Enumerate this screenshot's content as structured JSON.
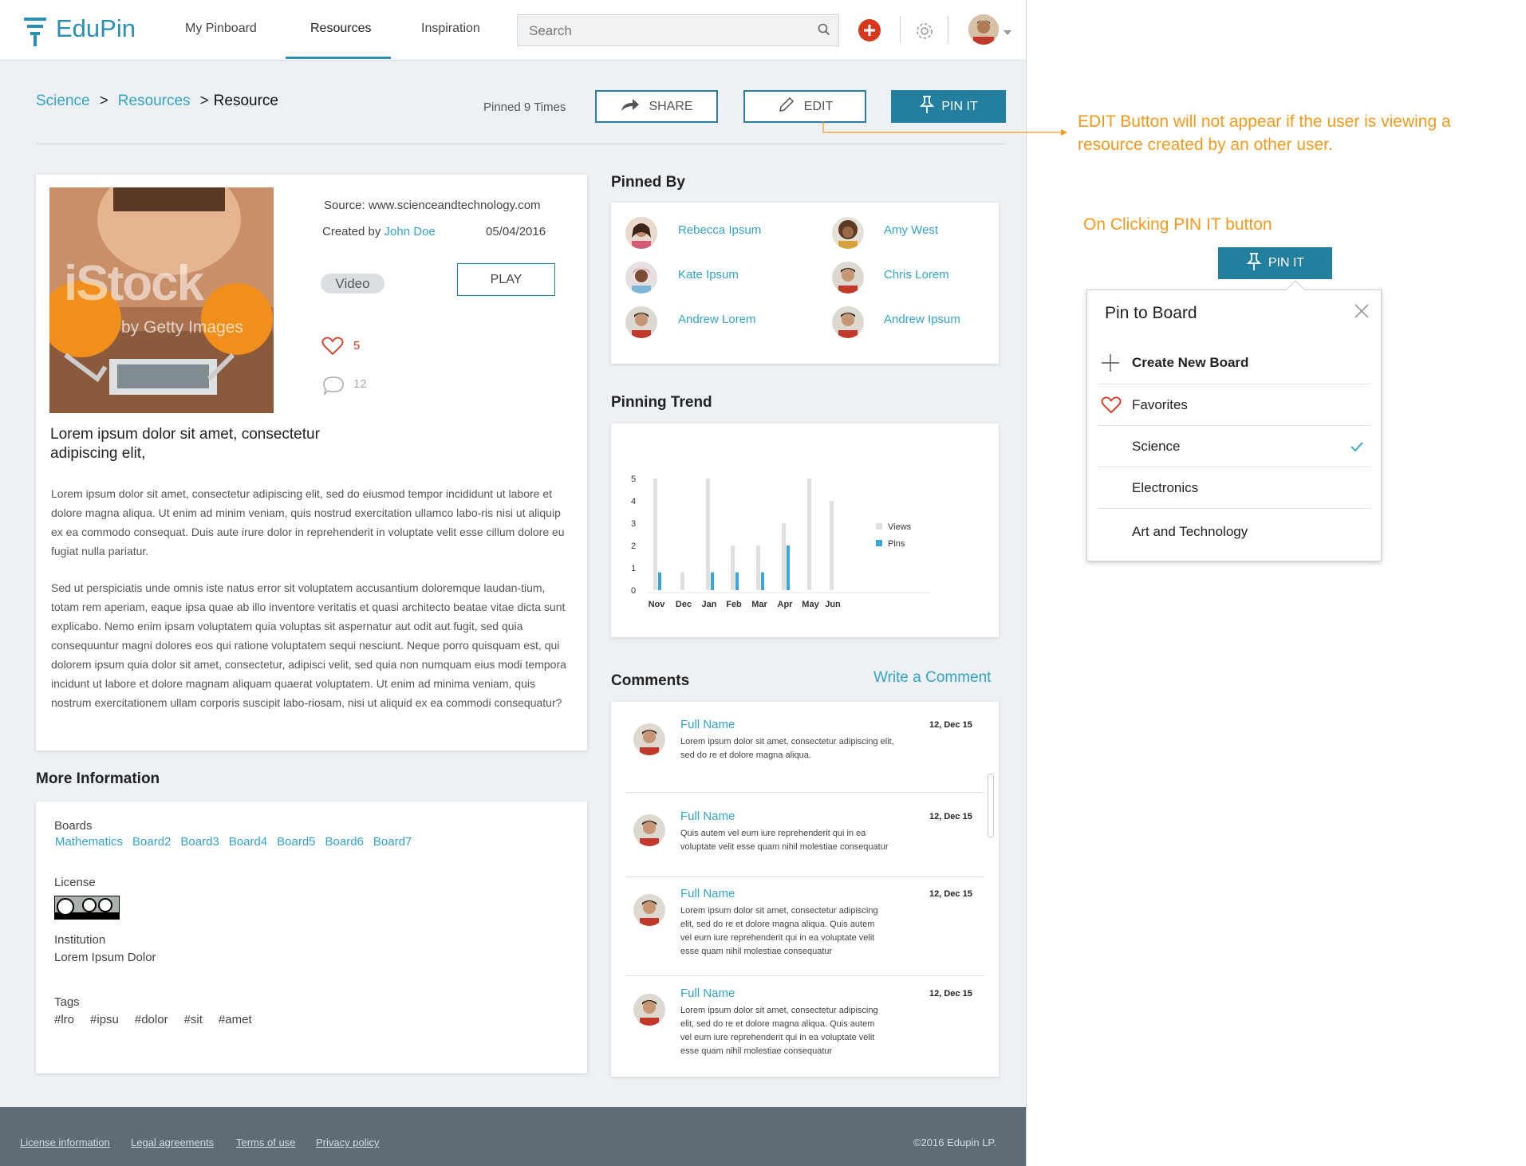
{
  "brand": {
    "name": "EduPin"
  },
  "nav": {
    "items": [
      "My Pinboard",
      "Resources",
      "Inspiration"
    ],
    "active_index": 1
  },
  "search": {
    "placeholder": "Search"
  },
  "breadcrumb": {
    "items": [
      "Science",
      "Resources"
    ],
    "current": "Resource",
    "separator": ">"
  },
  "actions": {
    "pinned_count": "Pinned 9 Times",
    "share": "SHARE",
    "edit": "EDIT",
    "pin_it": "PIN IT"
  },
  "resource": {
    "image_watermark": "iStock",
    "image_watermark_sub": "by Getty Images",
    "source": "Source: www.scienceandtechnology.com",
    "created_by_label": "Created by",
    "author": "John Doe",
    "date": "05/04/2016",
    "type_badge": "Video",
    "play": "PLAY",
    "likes": "5",
    "comments_count": "12",
    "title": "Lorem ipsum dolor sit amet, consectetur adipiscing elit,",
    "paragraph1": "Lorem ipsum dolor sit amet, consectetur adipiscing elit, sed do eiusmod tempor incididunt ut labore et dolore magna aliqua. Ut enim ad minim veniam, quis nostrud exercitation ullamco labo-ris nisi ut aliquip ex ea commodo consequat. Duis aute irure dolor in reprehenderit in voluptate velit esse cillum dolore eu fugiat nulla pariatur.",
    "paragraph2": "Sed ut perspiciatis unde omnis iste natus error sit voluptatem accusantium doloremque laudan-tium, totam rem aperiam, eaque ipsa quae ab illo inventore veritatis et quasi architecto beatae vitae dicta sunt explicabo. Nemo enim ipsam voluptatem quia voluptas sit aspernatur aut odit aut fugit, sed quia consequuntur magni dolores eos qui ratione voluptatem sequi nesciunt. Neque porro quisquam est, qui dolorem ipsum quia dolor sit amet, consectetur, adipisci velit, sed quia non numquam eius modi tempora incidunt ut labore et dolore magnam aliquam quaerat voluptatem. Ut enim ad minima veniam, quis nostrum exercitationem ullam corporis suscipit labo-riosam, nisi ut aliquid ex ea commodi consequatur?"
  },
  "more_info": {
    "title": "More Information",
    "boards_label": "Boards",
    "boards": [
      "Mathematics",
      "Board2",
      "Board3",
      "Board4",
      "Board5",
      "Board6",
      "Board7"
    ],
    "license_label": "License",
    "institution_label": "Institution",
    "institution": "Lorem Ipsum Dolor",
    "tags_label": "Tags",
    "tags": [
      "#lro",
      "#ipsu",
      "#dolor",
      "#sit",
      "#amet"
    ]
  },
  "pinned_by": {
    "title": "Pinned By",
    "users": [
      "Rebecca Ipsum",
      "Amy West",
      "Kate Ipsum",
      "Chris Lorem",
      "Andrew Lorem",
      "Andrew Ipsum"
    ]
  },
  "trend": {
    "title": "Pinning Trend",
    "legend": [
      "Views",
      "Pins"
    ]
  },
  "chart_data": {
    "type": "bar",
    "categories": [
      "Nov",
      "Dec",
      "Jan",
      "Feb",
      "Mar",
      "Apr",
      "May",
      "Jun"
    ],
    "series": [
      {
        "name": "Views",
        "values": [
          5,
          0.8,
          5,
          2,
          2,
          3,
          5,
          4
        ],
        "color": "#e0e0e0"
      },
      {
        "name": "Pins",
        "values": [
          0.8,
          0,
          0.8,
          0.8,
          0.8,
          2,
          0,
          0
        ],
        "color": "#3aa6d8"
      }
    ],
    "ylim": [
      0,
      5
    ],
    "yticks": [
      0,
      1,
      2,
      3,
      4,
      5
    ],
    "legend_position": "right"
  },
  "comments": {
    "title": "Comments",
    "write": "Write a Comment",
    "items": [
      {
        "name": "Full Name",
        "date": "12, Dec 15",
        "lines": [
          "Lorem ipsum dolor sit amet, consectetur adipiscing elit,",
          "sed do re et dolore magna aliqua."
        ]
      },
      {
        "name": "Full Name",
        "date": "12, Dec 15",
        "lines": [
          "Quis autem vel eum iure reprehenderit qui in ea",
          "voluptate velit esse quam nihil molestiae consequatur"
        ]
      },
      {
        "name": "Full Name",
        "date": "12, Dec 15",
        "lines": [
          "Lorem ipsum dolor sit amet, consectetur adipiscing",
          "elit, sed do re et dolore magna aliqua. Quis autem",
          "vel eum iure reprehenderit qui in ea voluptate velit",
          "esse quam nihil molestiae consequatur"
        ]
      },
      {
        "name": "Full Name",
        "date": "12, Dec 15",
        "lines": [
          "Lorem ipsum dolor sit amet, consectetur adipiscing",
          "elit, sed do re et dolore magna aliqua. Quis autem",
          "vel eum iure reprehenderit qui in ea voluptate velit",
          "esse quam nihil molestiae consequatur"
        ]
      }
    ]
  },
  "footer": {
    "links": [
      "License information",
      "Legal agreements",
      "Terms of use",
      "Privacy policy"
    ],
    "copyright": "©2016 Edupin LP."
  },
  "annotations": {
    "edit_note": "EDIT Button will not appear if the user is viewing a resource created by an other user.",
    "pin_note": "On Clicking PIN IT button"
  },
  "pin_popup": {
    "button": "PIN IT",
    "title": "Pin to Board",
    "create": "Create New Board",
    "items": [
      "Favorites",
      "Science",
      "Electronics",
      "Art and Technology"
    ],
    "checked_index": 1
  },
  "colors": {
    "accent": "#33a3c6",
    "primary_button": "#227f9d",
    "annotation": "#f39a1e",
    "footer": "#5f6c75"
  }
}
